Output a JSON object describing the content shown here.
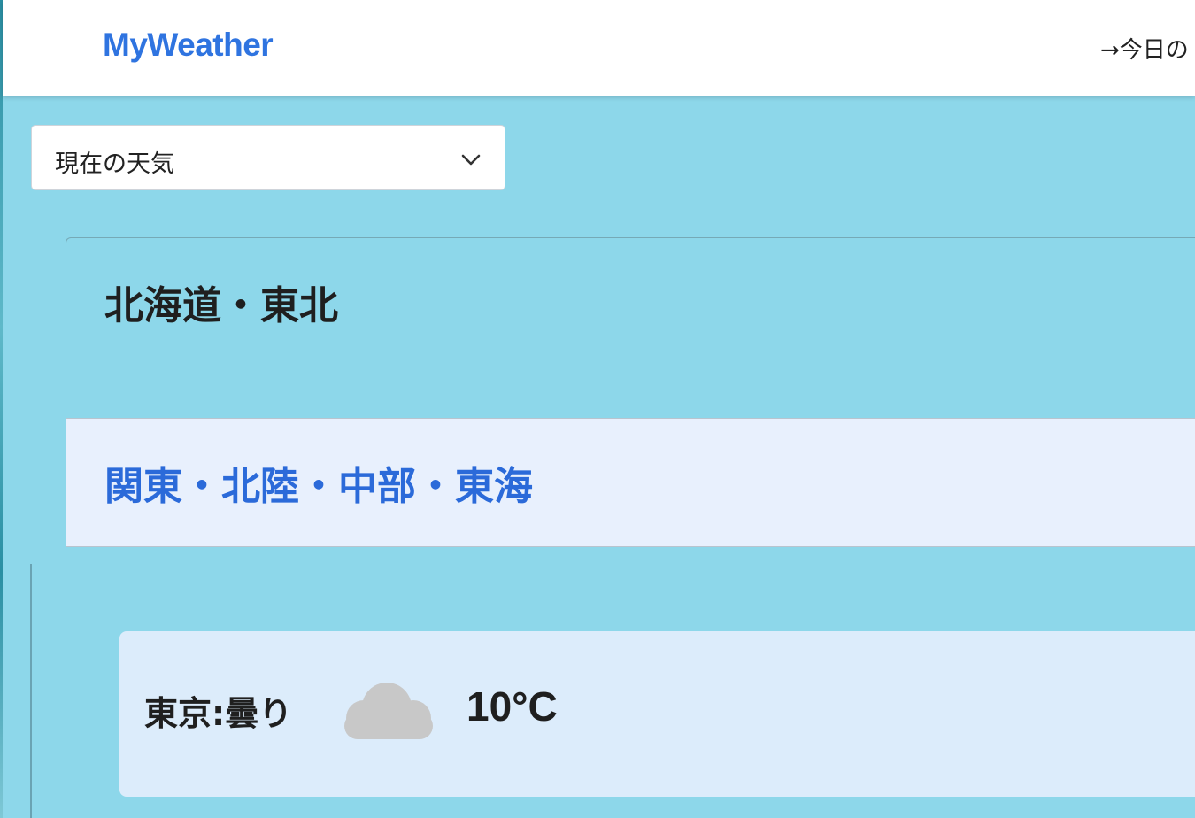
{
  "app": {
    "brand": "MyWeather"
  },
  "nav": {
    "link_label": "→今日の"
  },
  "selector": {
    "selected": "現在の天気"
  },
  "regions": [
    {
      "title": "北海道・東北"
    },
    {
      "title": "関東・北陸・中部・東海"
    }
  ],
  "weather": {
    "city_label": "東京:曇り",
    "icon": "cloud-icon",
    "temperature": "10°C"
  },
  "colors": {
    "page_bg": "#8dd7ea",
    "brand": "#2f74e0",
    "active_region": "#2b6ad9",
    "active_region_bg": "#e8f0fd",
    "card_bg": "#dcecfb"
  }
}
